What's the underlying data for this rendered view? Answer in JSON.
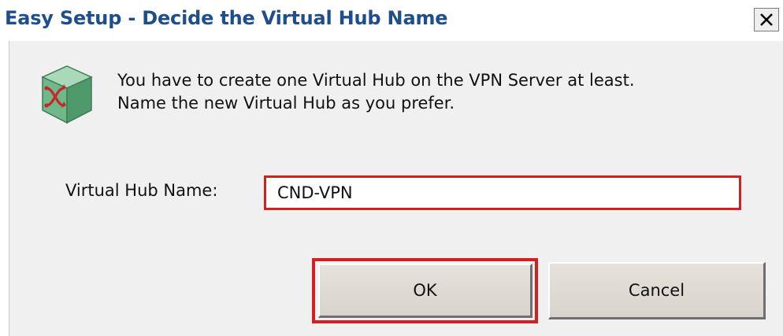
{
  "window": {
    "title": "Easy Setup - Decide the Virtual Hub Name",
    "close_glyph": "X"
  },
  "message": {
    "line1": "You have to create one Virtual Hub on the VPN Server at least.",
    "line2": "Name the new Virtual Hub as you prefer."
  },
  "form": {
    "hub_name_label": "Virtual Hub Name:",
    "hub_name_value": "CND-VPN"
  },
  "buttons": {
    "ok_label": "OK",
    "cancel_label": "Cancel"
  },
  "icons": {
    "dialog_icon": "virtual-hub-icon",
    "close_icon": "close-icon"
  },
  "colors": {
    "title_text": "#1f4e8c",
    "highlight": "#d21f1f",
    "dialog_bg": "#f0f0f0",
    "hub_icon_green": "#5fae7e",
    "hub_icon_arrows": "#c8262a"
  }
}
